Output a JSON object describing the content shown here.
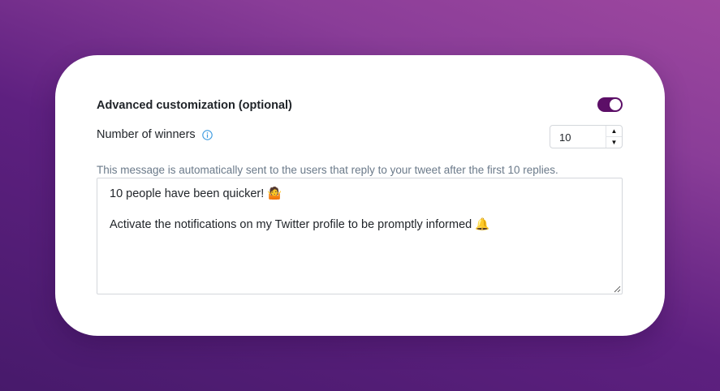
{
  "settings": {
    "advanced_title": "Advanced customization (optional)",
    "advanced_enabled": true,
    "winners_label": "Number of winners",
    "winners_value": "10",
    "hint": "This message is automatically sent to the users that reply to your tweet after the first 10 replies.",
    "message_line1": "10 people have been quicker! 🤷",
    "message_line2": "Activate the notifications on my Twitter profile to be promptly informed 🔔"
  },
  "colors": {
    "accent": "#5c0f67",
    "hint": "#6b7a8a",
    "info_icon": "#3b9ae0"
  },
  "icons": {
    "info": "info-icon",
    "increment": "chevron-up-icon",
    "decrement": "chevron-down-icon",
    "resize": "resize-grip-icon"
  }
}
